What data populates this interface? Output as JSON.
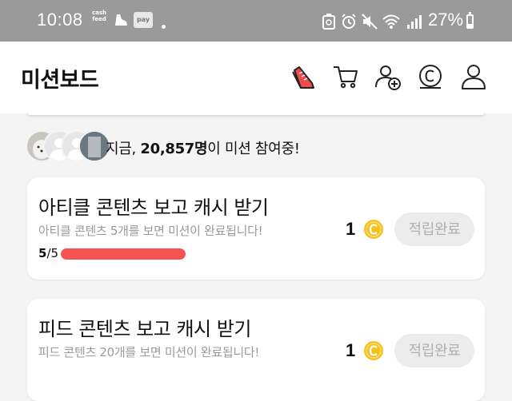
{
  "status_bar": {
    "time": "10:08",
    "cashfeed_line1": "cash",
    "cashfeed_line2": "feed",
    "pay_label": "pay",
    "battery_text": "27%",
    "battery_level": 0.27
  },
  "header": {
    "title": "미션보드",
    "icons": [
      "sneaker-icon",
      "cart-icon",
      "add-friend-icon",
      "coin-icon",
      "profile-icon"
    ]
  },
  "participants": {
    "prefix": "지금, ",
    "count": "20,857명",
    "suffix": "이 미션 참여중!"
  },
  "missions": [
    {
      "title": "아티클 콘텐츠 보고 캐시 받기",
      "description": "아티클 콘텐츠 5개를 보면 미션이 완료됩니다!",
      "progress_done": "5",
      "progress_total": "/5",
      "progress_fraction": 1.0,
      "reward": "1",
      "button_label": "적립완료"
    },
    {
      "title": "피드 콘텐츠 보고 캐시 받기",
      "description": "피드 콘텐츠 20개를 보면 미션이 완료됩니다!",
      "reward": "1",
      "button_label": "적립완료"
    }
  ],
  "colors": {
    "progress": "#f55252",
    "status_bar_bg": "#9a9a9a",
    "coin": "#f5c21b",
    "sneaker": "#ef4b4b"
  }
}
